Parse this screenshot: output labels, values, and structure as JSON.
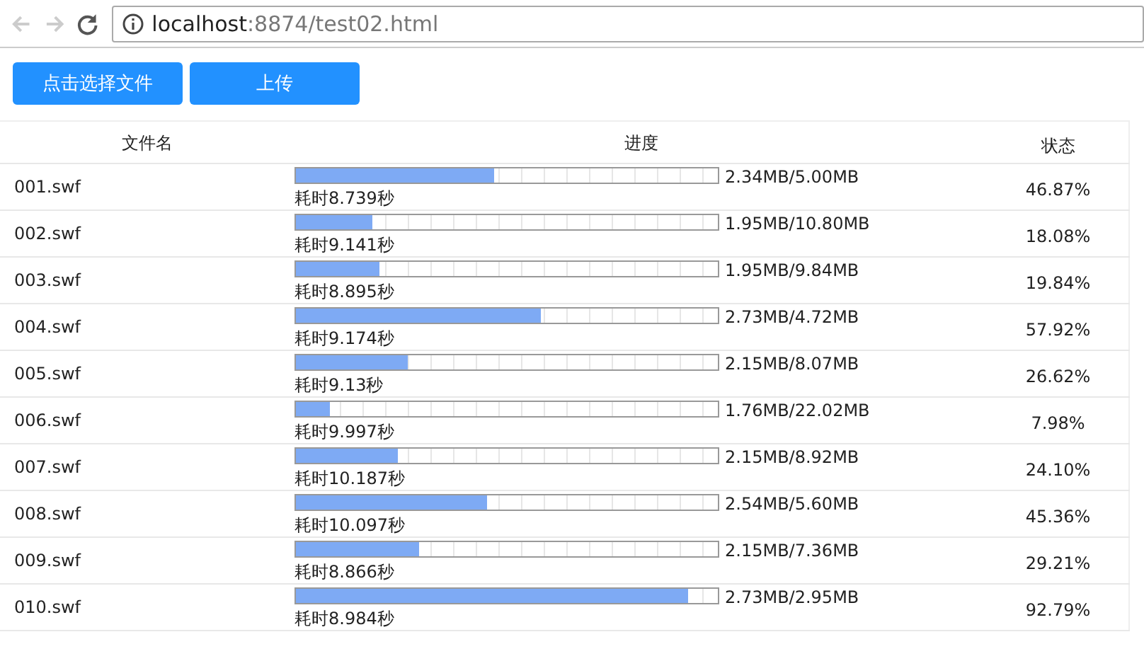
{
  "browser": {
    "url_host": "localhost",
    "url_path": ":8874/test02.html"
  },
  "buttons": [
    "点击选择文件",
    "上传"
  ],
  "table": {
    "columns": [
      "文件名",
      "进度",
      "状态"
    ],
    "rows": [
      {
        "name": "001.swf",
        "level": 0.4687,
        "size": "2.34MB/5.00MB",
        "time": "耗时8.739秒",
        "status": "46.87%"
      },
      {
        "name": "002.swf",
        "level": 0.1808,
        "size": "1.95MB/10.80MB",
        "time": "耗时9.141秒",
        "status": "18.08%"
      },
      {
        "name": "003.swf",
        "level": 0.1984,
        "size": "1.95MB/9.84MB",
        "time": "耗时8.895秒",
        "status": "19.84%"
      },
      {
        "name": "004.swf",
        "level": 0.5792,
        "size": "2.73MB/4.72MB",
        "time": "耗时9.174秒",
        "status": "57.92%"
      },
      {
        "name": "005.swf",
        "level": 0.2662,
        "size": "2.15MB/8.07MB",
        "time": "耗时9.13秒",
        "status": "26.62%"
      },
      {
        "name": "006.swf",
        "level": 0.0798,
        "size": "1.76MB/22.02MB",
        "time": "耗时9.997秒",
        "status": "7.98%"
      },
      {
        "name": "007.swf",
        "level": 0.241,
        "size": "2.15MB/8.92MB",
        "time": "耗时10.187秒",
        "status": "24.10%"
      },
      {
        "name": "008.swf",
        "level": 0.4536,
        "size": "2.54MB/5.60MB",
        "time": "耗时10.097秒",
        "status": "45.36%"
      },
      {
        "name": "009.swf",
        "level": 0.2921,
        "size": "2.15MB/7.36MB",
        "time": "耗时8.866秒",
        "status": "29.21%"
      },
      {
        "name": "010.swf",
        "level": 0.9279,
        "size": "2.73MB/2.95MB",
        "time": "耗时8.984秒",
        "status": "92.79%"
      }
    ]
  }
}
